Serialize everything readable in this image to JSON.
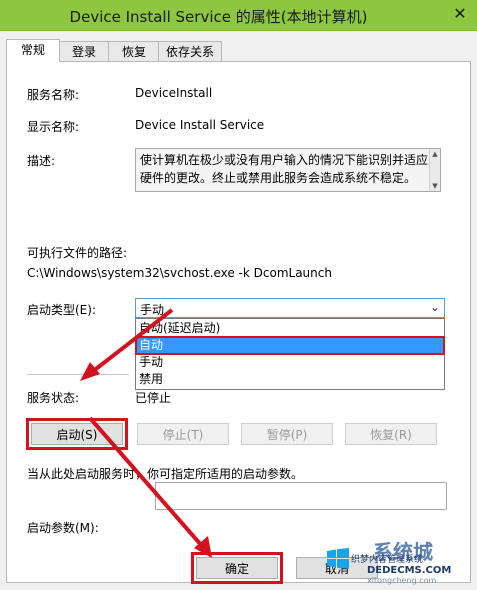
{
  "window": {
    "title": "Device Install Service 的属性(本地计算机)",
    "close_glyph": "✕"
  },
  "tabs": [
    "常规",
    "登录",
    "恢复",
    "依存关系"
  ],
  "general": {
    "service_name_label": "服务名称:",
    "service_name_value": "DeviceInstall",
    "display_name_label": "显示名称:",
    "display_name_value": "Device Install Service",
    "description_label": "描述:",
    "description_text": "使计算机在极少或没有用户输入的情况下能识别并适应硬件的更改。终止或禁用此服务会造成系统不稳定。",
    "path_label": "可执行文件的路径:",
    "path_value": "C:\\Windows\\system32\\svchost.exe -k DcomLaunch",
    "startup_type_label": "启动类型(E):",
    "startup_type_value": "手动",
    "startup_options": [
      "自动(延迟启动)",
      "自动",
      "手动",
      "禁用"
    ],
    "selected_option_index": 1,
    "service_status_label": "服务状态:",
    "service_status_value": "已停止",
    "buttons": {
      "start": "启动(S)",
      "stop": "停止(T)",
      "pause": "暂停(P)",
      "resume": "恢复(R)"
    },
    "hint_text": "当从此处启动服务时，你可指定所适用的启动参数。",
    "start_params_label": "启动参数(M):",
    "start_params_value": ""
  },
  "footer": {
    "ok": "确定",
    "cancel": "取消"
  },
  "watermark": {
    "brand": "系统城",
    "line1": "织梦内容管理系统",
    "line2": "DEDECMS.COM",
    "line3": "xitongcheng.com"
  },
  "colors": {
    "titlebar": "#8dc63f",
    "highlight": "#d4121f",
    "selection": "#3399ff"
  }
}
